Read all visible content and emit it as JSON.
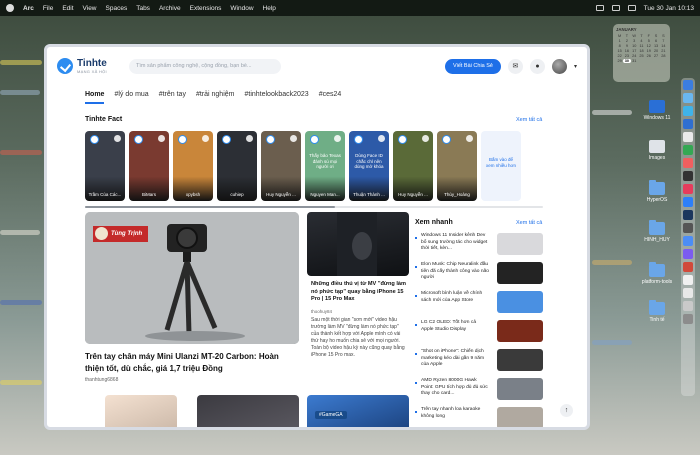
{
  "menubar": {
    "app": "Arc",
    "items": [
      "File",
      "Edit",
      "View",
      "Spaces",
      "Tabs",
      "Archive",
      "Extensions",
      "Window",
      "Help"
    ],
    "datetime": "Tue 30 Jan  10:13"
  },
  "site": {
    "logo_name": "Tinhte",
    "logo_sub": "MẠNG XÃ HỘI",
    "search_placeholder": "Tìm sản phẩm công nghệ, cộng đồng, bạn bè...",
    "write_button": "Viết Bài Chia Sẻ",
    "tabs": [
      "Home",
      "#lý do mua",
      "#trên tay",
      "#trải nghiệm",
      "#tinhtelookback2023",
      "#ces24"
    ]
  },
  "fact": {
    "title": "Tinhte Fact",
    "see_all": "Xem tất cả",
    "stories": [
      {
        "label": "Trầm Của Các...",
        "overlay": "",
        "color": "#3a3f4a"
      },
      {
        "label": "BiMars",
        "overlay": "",
        "color": "#7a3a30"
      },
      {
        "label": "xpybsh",
        "overlay": "",
        "color": "#c9863a"
      },
      {
        "label": "cuhiep",
        "overlay": "",
        "color": "#2c2f35"
      },
      {
        "label": "Huy Nguyễn ...",
        "overlay": "",
        "color": "#6b5e4e"
      },
      {
        "label": "Nguyen Man...",
        "overlay": "Thấy bảo Texas đánh sú mọi người ơi",
        "color": "#6fae86"
      },
      {
        "label": "Thuận Thành ...",
        "overlay": "Dùng Face ID chắc chỉ nên dùng mở khóa",
        "color": "#2d5aa8"
      },
      {
        "label": "Huy Nguyễn ...",
        "overlay": "",
        "color": "#5a6a38"
      },
      {
        "label": "Thủy_Hoàng",
        "overlay": "",
        "color": "#8a7a55"
      }
    ],
    "more": "Bấm vào để xem nhiều hơn"
  },
  "hero": {
    "tag_name": "Tùng Trịnh",
    "title": "Trên tay chân máy Mini Ulanzi MT-20 Carbon: Hoàn thiện tốt, dù chắc, giá 1,7 triệu Đồng",
    "author": "thanhtung6868"
  },
  "card2": {
    "title": "Những điều thú vị từ MV \"đừng làm nó phức tạp\" quay bằng iPhone 15 Pro | 15 Pro Max",
    "author": "thoohuy84",
    "desc": "Sau một thời gian \"sơn mới\" video hậu trường làm MV \"đừng làm nó phức tạp\" của thành kết hợp với Apple mình có vài thứ hay ho muốn chia sẻ với mọi người. Toàn bộ video hậu kỳ này cũng quay bằng iPhone 15 Pro max."
  },
  "news": {
    "title": "Xem nhanh",
    "see_all": "Xem tất cả",
    "items": [
      {
        "text": "Windows 11 Insider kênh Dev bổ sung trường tác cho widget thời tiết, kèn...",
        "color": "#d9d9dc"
      },
      {
        "text": "Elon Musk: Chip Neuralink đầu tiên đã cấy thành công vào não người",
        "color": "#232323"
      },
      {
        "text": "Microsoft bình luận về chính sách mới của App Store",
        "color": "#4a90e2"
      },
      {
        "text": "LG C2 OLED: Tốt hơn cả Apple Studio Display",
        "color": "#7a2a1a"
      },
      {
        "text": "\"Shot on iPhone\": Chiến dịch marketing kéo dài gần 9 năm của Apple",
        "color": "#3a3a3a"
      },
      {
        "text": "AMD Ryzen 8000G Hawk Point: GPU tích hợp đủ đủ sức thay cho card...",
        "color": "#7a8088"
      },
      {
        "text": "Trên tay nhanh loa karaoke không long",
        "color": "#b0a9a0"
      }
    ]
  },
  "row3": {
    "gamega": "#GameGA"
  },
  "calendar": {
    "month": "JANUARY",
    "weekdays": [
      "M",
      "T",
      "W",
      "T",
      "F",
      "S",
      "S"
    ],
    "days": [
      "1",
      "2",
      "3",
      "4",
      "5",
      "6",
      "7",
      "8",
      "9",
      "10",
      "11",
      "12",
      "13",
      "14",
      "15",
      "16",
      "17",
      "18",
      "19",
      "20",
      "21",
      "22",
      "23",
      "24",
      "25",
      "26",
      "27",
      "28",
      "29",
      "30",
      "31"
    ],
    "today": "30"
  },
  "desktop_icons": [
    "Windows 11",
    "Images",
    "HyperOS",
    "HINH_HUY",
    "platform-tools",
    "Tinh tế"
  ]
}
